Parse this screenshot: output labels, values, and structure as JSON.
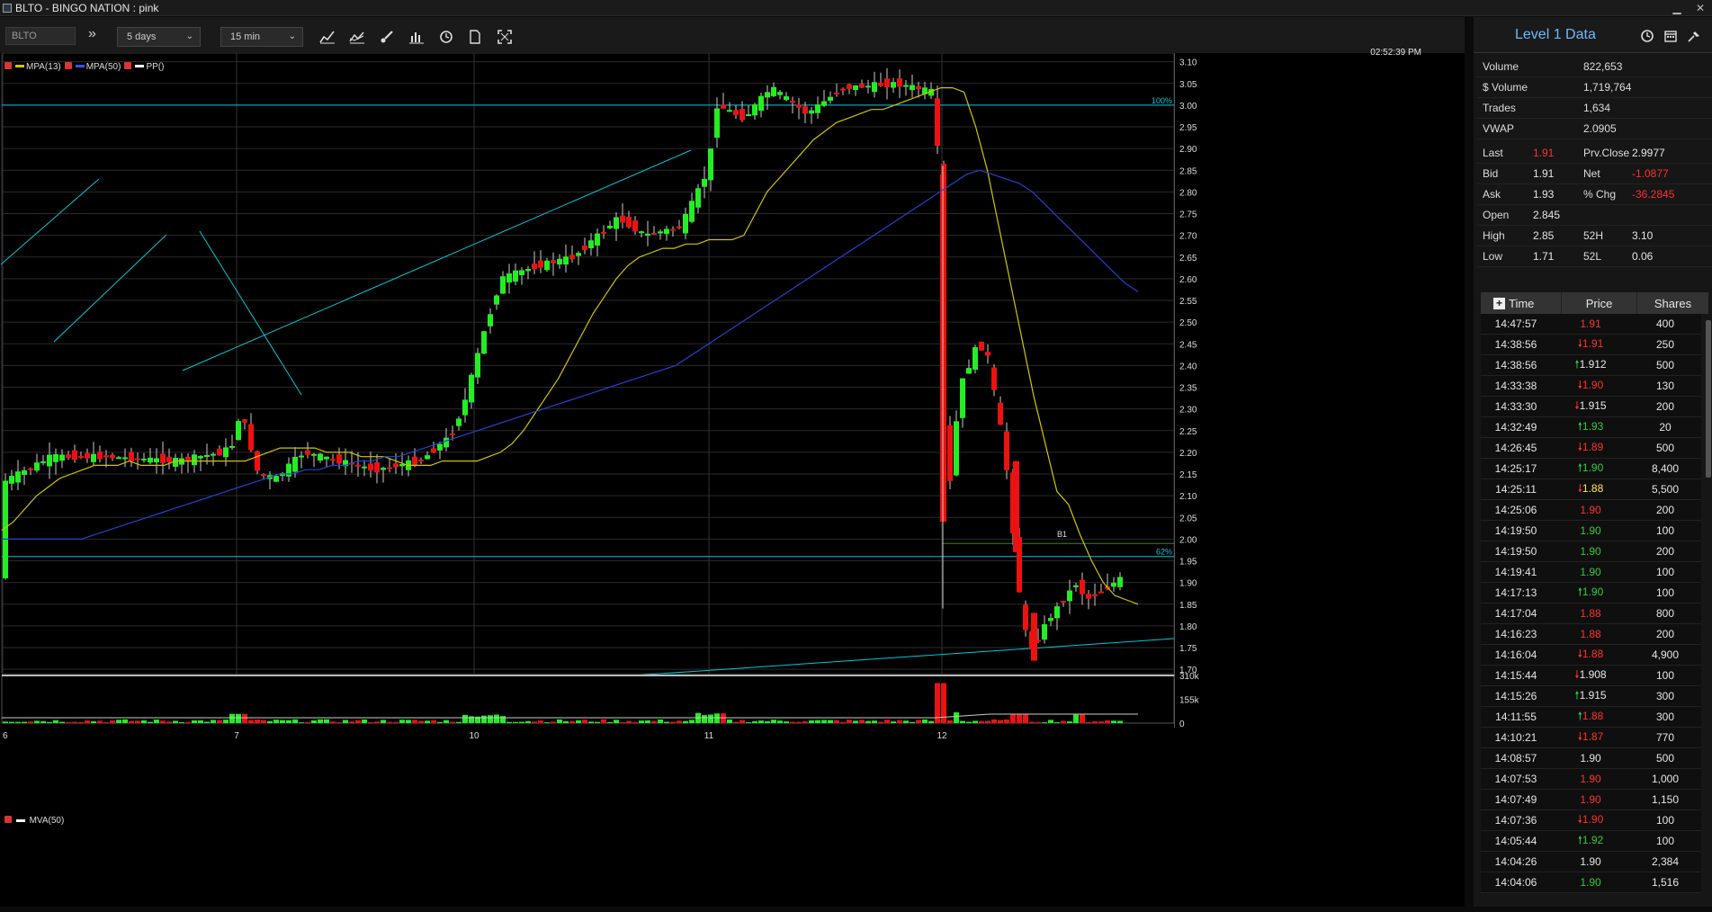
{
  "window": {
    "title": "BLTO - BINGO NATION : pink",
    "min_label": "▁",
    "close_label": "✕"
  },
  "toolbar": {
    "symbol": "BLTO",
    "more_label": "»",
    "range": "5 days",
    "interval": "15 min",
    "icons": [
      "line-chart-icon",
      "indicator-chart-icon",
      "brush-icon",
      "bar-chart-icon",
      "clock-icon",
      "document-icon",
      "fullscreen-icon"
    ]
  },
  "chart": {
    "timestamp": "02:52:39 PM",
    "legend": {
      "s1": "MPA(13)",
      "s2": "MPA(50)",
      "s3": "PP()",
      "vol": "MVA(50)"
    },
    "fib_100": "100%",
    "fib_62": "62%",
    "marker_b1": "B1",
    "colors": {
      "up": "#22ee22",
      "down": "#ee1111",
      "ma13": "#d4c400",
      "ma50": "#2244cc",
      "draw": "#00c8d8"
    }
  },
  "chart_data": {
    "type": "candlestick",
    "symbol": "BLTO",
    "interval": "15 min",
    "range": "5 days",
    "x_ticks": [
      "6",
      "7",
      "10",
      "11",
      "12"
    ],
    "y_ticks": [
      "3.10",
      "3.05",
      "3.00",
      "2.95",
      "2.90",
      "2.85",
      "2.80",
      "2.75",
      "2.70",
      "2.65",
      "2.60",
      "2.55",
      "2.50",
      "2.45",
      "2.40",
      "2.35",
      "2.30",
      "2.25",
      "2.20",
      "2.15",
      "2.10",
      "2.05",
      "2.00",
      "1.95",
      "1.90",
      "1.85",
      "1.80",
      "1.75",
      "1.70"
    ],
    "ylim": [
      1.69,
      3.12
    ],
    "volume_ticks": [
      "310k",
      "155k",
      "0"
    ],
    "volume_ylim": [
      0,
      310000
    ],
    "series": [
      {
        "name": "MPA(13)",
        "values": [
          2.02,
          2.04,
          2.07,
          2.1,
          2.12,
          2.14,
          2.15,
          2.16,
          2.17,
          2.17,
          2.17,
          2.18,
          2.17,
          2.17,
          2.17,
          2.18,
          2.18,
          2.18,
          2.18,
          2.18,
          2.18,
          2.18,
          2.19,
          2.2,
          2.21,
          2.21,
          2.21,
          2.21,
          2.2,
          2.2,
          2.2,
          2.19,
          2.19,
          2.19,
          2.18,
          2.17,
          2.17,
          2.17,
          2.18,
          2.18,
          2.18,
          2.18,
          2.19,
          2.2,
          2.22,
          2.25,
          2.29,
          2.33,
          2.37,
          2.42,
          2.47,
          2.52,
          2.56,
          2.6,
          2.63,
          2.65,
          2.66,
          2.67,
          2.67,
          2.68,
          2.68,
          2.69,
          2.69,
          2.69,
          2.7,
          2.75,
          2.8,
          2.83,
          2.86,
          2.89,
          2.92,
          2.94,
          2.96,
          2.97,
          2.98,
          2.99,
          2.99,
          3.0,
          3.01,
          3.02,
          3.03,
          3.04,
          3.04,
          3.03,
          2.95,
          2.85,
          2.72,
          2.59,
          2.46,
          2.33,
          2.22,
          2.11,
          2.08,
          2.01,
          1.95,
          1.9,
          1.87,
          1.86,
          1.85
        ]
      },
      {
        "name": "MPA(50)",
        "values": [
          2.0,
          2.0,
          2.0,
          2.0,
          2.0,
          2.0,
          2.0,
          2.01,
          2.02,
          2.03,
          2.04,
          2.05,
          2.06,
          2.07,
          2.08,
          2.09,
          2.1,
          2.11,
          2.12,
          2.13,
          2.14,
          2.15,
          2.15,
          2.16,
          2.16,
          2.17,
          2.17,
          2.18,
          2.18,
          2.19,
          2.19,
          2.2,
          2.21,
          2.22,
          2.23,
          2.24,
          2.25,
          2.26,
          2.27,
          2.28,
          2.29,
          2.3,
          2.31,
          2.32,
          2.33,
          2.34,
          2.35,
          2.36,
          2.37,
          2.38,
          2.39,
          2.4,
          2.42,
          2.44,
          2.46,
          2.48,
          2.5,
          2.52,
          2.54,
          2.56,
          2.58,
          2.6,
          2.62,
          2.64,
          2.66,
          2.68,
          2.7,
          2.72,
          2.74,
          2.76,
          2.78,
          2.8,
          2.82,
          2.84,
          2.85,
          2.84,
          2.83,
          2.82,
          2.8,
          2.77,
          2.74,
          2.71,
          2.68,
          2.65,
          2.62,
          2.59,
          2.57
        ]
      }
    ]
  },
  "level1": {
    "title": "Level 1 Data",
    "icons": [
      "clock-icon",
      "calendar-icon",
      "pin-icon"
    ],
    "rows1": [
      {
        "label": "Volume",
        "value": "822,653"
      },
      {
        "label": "$ Volume",
        "value": "1,719,764"
      },
      {
        "label": "Trades",
        "value": "1,634"
      },
      {
        "label": "VWAP",
        "value": "2.0905"
      }
    ],
    "rows2": [
      {
        "l1": "Last",
        "v1": "1.91",
        "c1": "down",
        "l2": "Prv.Close",
        "v2": "2.9977",
        "c2": "neu"
      },
      {
        "l1": "Bid",
        "v1": "1.91",
        "c1": "neu",
        "l2": "Net",
        "v2": "-1.0877",
        "c2": "down"
      },
      {
        "l1": "Ask",
        "v1": "1.93",
        "c1": "neu",
        "l2": "% Chg",
        "v2": "-36.2845",
        "c2": "down"
      },
      {
        "l1": "Open",
        "v1": "2.845",
        "c1": "neu",
        "l2": "",
        "v2": "",
        "c2": "neu"
      },
      {
        "l1": "High",
        "v1": "2.85",
        "c1": "neu",
        "l2": "52H",
        "v2": "3.10",
        "c2": "neu"
      },
      {
        "l1": "Low",
        "v1": "1.71",
        "c1": "neu",
        "l2": "52L",
        "v2": "0.06",
        "c2": "neu"
      }
    ]
  },
  "trades": {
    "columns": {
      "time": "Time",
      "price": "Price",
      "shares": "Shares"
    },
    "rows": [
      {
        "time": "14:47:57",
        "price": "1.91",
        "dir": "",
        "color": "down",
        "shares": "400"
      },
      {
        "time": "14:38:56",
        "price": "1.91",
        "dir": "down",
        "color": "down",
        "shares": "250"
      },
      {
        "time": "14:38:56",
        "price": "1.912",
        "dir": "up",
        "color": "neu",
        "shares": "500"
      },
      {
        "time": "14:33:38",
        "price": "1.90",
        "dir": "down",
        "color": "down",
        "shares": "130"
      },
      {
        "time": "14:33:30",
        "price": "1.915",
        "dir": "down",
        "color": "neu",
        "shares": "200"
      },
      {
        "time": "14:32:49",
        "price": "1.93",
        "dir": "up",
        "color": "up",
        "shares": "20"
      },
      {
        "time": "14:26:45",
        "price": "1.89",
        "dir": "down",
        "color": "down",
        "shares": "500"
      },
      {
        "time": "14:25:17",
        "price": "1.90",
        "dir": "up",
        "color": "up",
        "shares": "8,400"
      },
      {
        "time": "14:25:11",
        "price": "1.88",
        "dir": "down",
        "color": "yel",
        "shares": "5,500"
      },
      {
        "time": "14:25:06",
        "price": "1.90",
        "dir": "",
        "color": "down",
        "shares": "200"
      },
      {
        "time": "14:19:50",
        "price": "1.90",
        "dir": "",
        "color": "up",
        "shares": "100"
      },
      {
        "time": "14:19:50",
        "price": "1.90",
        "dir": "",
        "color": "up",
        "shares": "200"
      },
      {
        "time": "14:19:41",
        "price": "1.90",
        "dir": "",
        "color": "up",
        "shares": "100"
      },
      {
        "time": "14:17:13",
        "price": "1.90",
        "dir": "up",
        "color": "up",
        "shares": "100"
      },
      {
        "time": "14:17:04",
        "price": "1.88",
        "dir": "",
        "color": "down",
        "shares": "800"
      },
      {
        "time": "14:16:23",
        "price": "1.88",
        "dir": "",
        "color": "down",
        "shares": "200"
      },
      {
        "time": "14:16:04",
        "price": "1.88",
        "dir": "down",
        "color": "down",
        "shares": "4,900"
      },
      {
        "time": "14:15:44",
        "price": "1.908",
        "dir": "down",
        "color": "neu",
        "shares": "100"
      },
      {
        "time": "14:15:26",
        "price": "1.915",
        "dir": "up",
        "color": "neu",
        "shares": "300"
      },
      {
        "time": "14:11:55",
        "price": "1.88",
        "dir": "up",
        "color": "down",
        "shares": "300"
      },
      {
        "time": "14:10:21",
        "price": "1.87",
        "dir": "down",
        "color": "down",
        "shares": "770"
      },
      {
        "time": "14:08:57",
        "price": "1.90",
        "dir": "",
        "color": "neu",
        "shares": "500"
      },
      {
        "time": "14:07:53",
        "price": "1.90",
        "dir": "",
        "color": "down",
        "shares": "1,000"
      },
      {
        "time": "14:07:49",
        "price": "1.90",
        "dir": "",
        "color": "down",
        "shares": "1,150"
      },
      {
        "time": "14:07:36",
        "price": "1.90",
        "dir": "down",
        "color": "down",
        "shares": "100"
      },
      {
        "time": "14:05:44",
        "price": "1.92",
        "dir": "up",
        "color": "up",
        "shares": "100"
      },
      {
        "time": "14:04:26",
        "price": "1.90",
        "dir": "",
        "color": "neu",
        "shares": "2,384"
      },
      {
        "time": "14:04:06",
        "price": "1.90",
        "dir": "",
        "color": "up",
        "shares": "1,516"
      }
    ]
  }
}
